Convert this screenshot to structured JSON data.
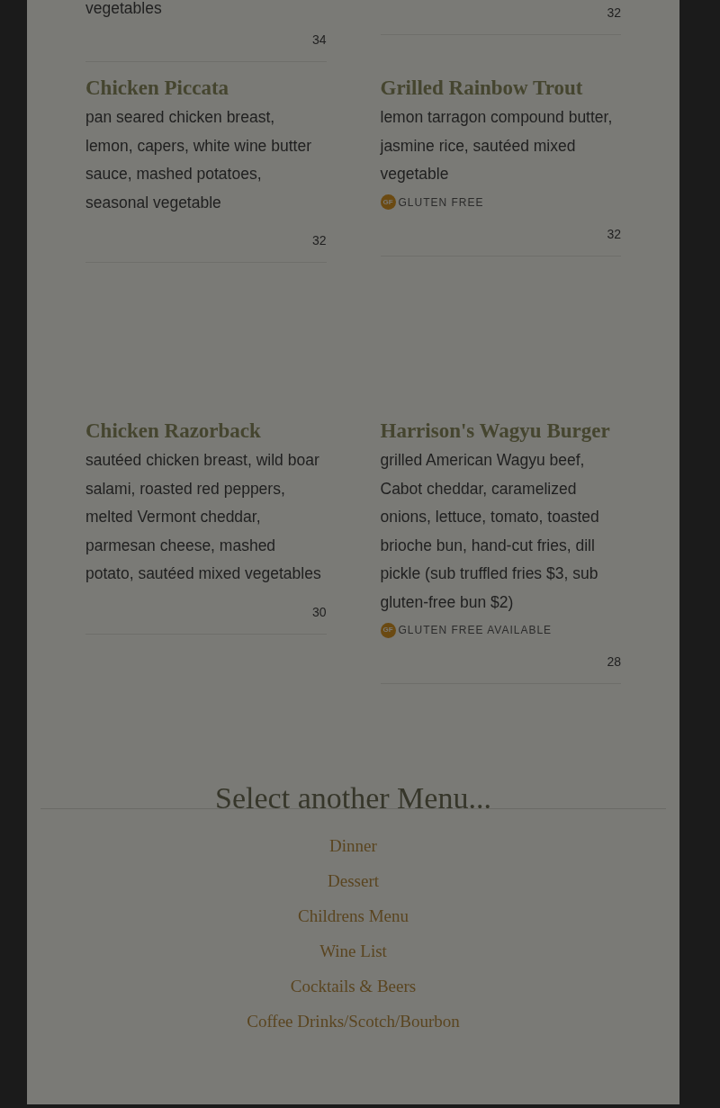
{
  "partial_items": [
    {
      "description": "vegetables",
      "price": "34"
    },
    {
      "price": "32"
    }
  ],
  "item_rows": [
    [
      {
        "name": "Chicken Piccata",
        "description": "pan seared chicken breast, lemon, capers, white wine butter sauce, mashed potatoes, seasonal vegetable",
        "price": "32"
      },
      {
        "name": "Grilled Rainbow Trout",
        "description": "lemon tarragon compound butter, jasmine rice, sautéed mixed vegetable",
        "badge": {
          "icon_text": "GF",
          "label": "GLUTEN FREE"
        },
        "price": "32"
      }
    ],
    [
      {
        "name": "Chicken Razorback",
        "description": "sautéed chicken breast, wild boar salami, roasted red peppers, melted Vermont cheddar, parmesan cheese, mashed potato, sautéed mixed vegetables",
        "price": "30"
      },
      {
        "name": "Harrison's Wagyu Burger",
        "description": "grilled American Wagyu beef, Cabot cheddar, caramelized onions, lettuce, tomato, toasted brioche bun, hand-cut fries, dill pickle (sub truffled fries $3, sub gluten-free bun $2)",
        "badge": {
          "icon_text": "GF",
          "label": "GLUTEN FREE AVAILABLE"
        },
        "price": "28"
      }
    ]
  ],
  "other_menus": {
    "heading": "Select another Menu...",
    "links": [
      "Dinner",
      "Dessert",
      "Childrens Menu",
      "Wine List",
      "Cocktails & Beers",
      "Coffee Drinks/Scotch/Bourbon"
    ]
  }
}
